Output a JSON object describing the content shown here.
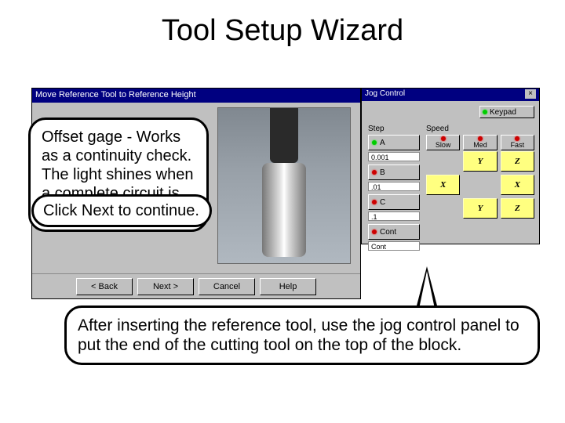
{
  "title": "Tool Setup Wizard",
  "wizard": {
    "titlebar": "Move Reference Tool to Reference Height",
    "buttons": {
      "back": "< Back",
      "next": "Next >",
      "cancel": "Cancel",
      "help": "Help"
    }
  },
  "jog": {
    "titlebar": "Jog Control",
    "keypad_label": "Keypad",
    "step_header": "Step",
    "speed_header": "Speed",
    "steps": {
      "a": {
        "label": "A",
        "val": "0.001"
      },
      "b": {
        "label": "B",
        "val": ".01"
      },
      "c": {
        "label": "C",
        "val": ".1"
      },
      "cont": {
        "label": "Cont",
        "val": "Cont"
      }
    },
    "speeds": {
      "slow": "Slow",
      "med": "Med",
      "fast": "Fast"
    },
    "axes": {
      "yplus": "Y",
      "zplus": "Z",
      "xminus": "X",
      "xplus": "X",
      "yminus": "Y",
      "zminus": "Z"
    }
  },
  "callouts": {
    "gage": "Offset gage - Works as a continuity check. The light shines when a complete circuit is tool and table.",
    "clicknext": "Click Next to continue.",
    "jogpanel": "After inserting the reference tool, use the jog control panel to put the end of the cutting tool on the top of the block."
  }
}
